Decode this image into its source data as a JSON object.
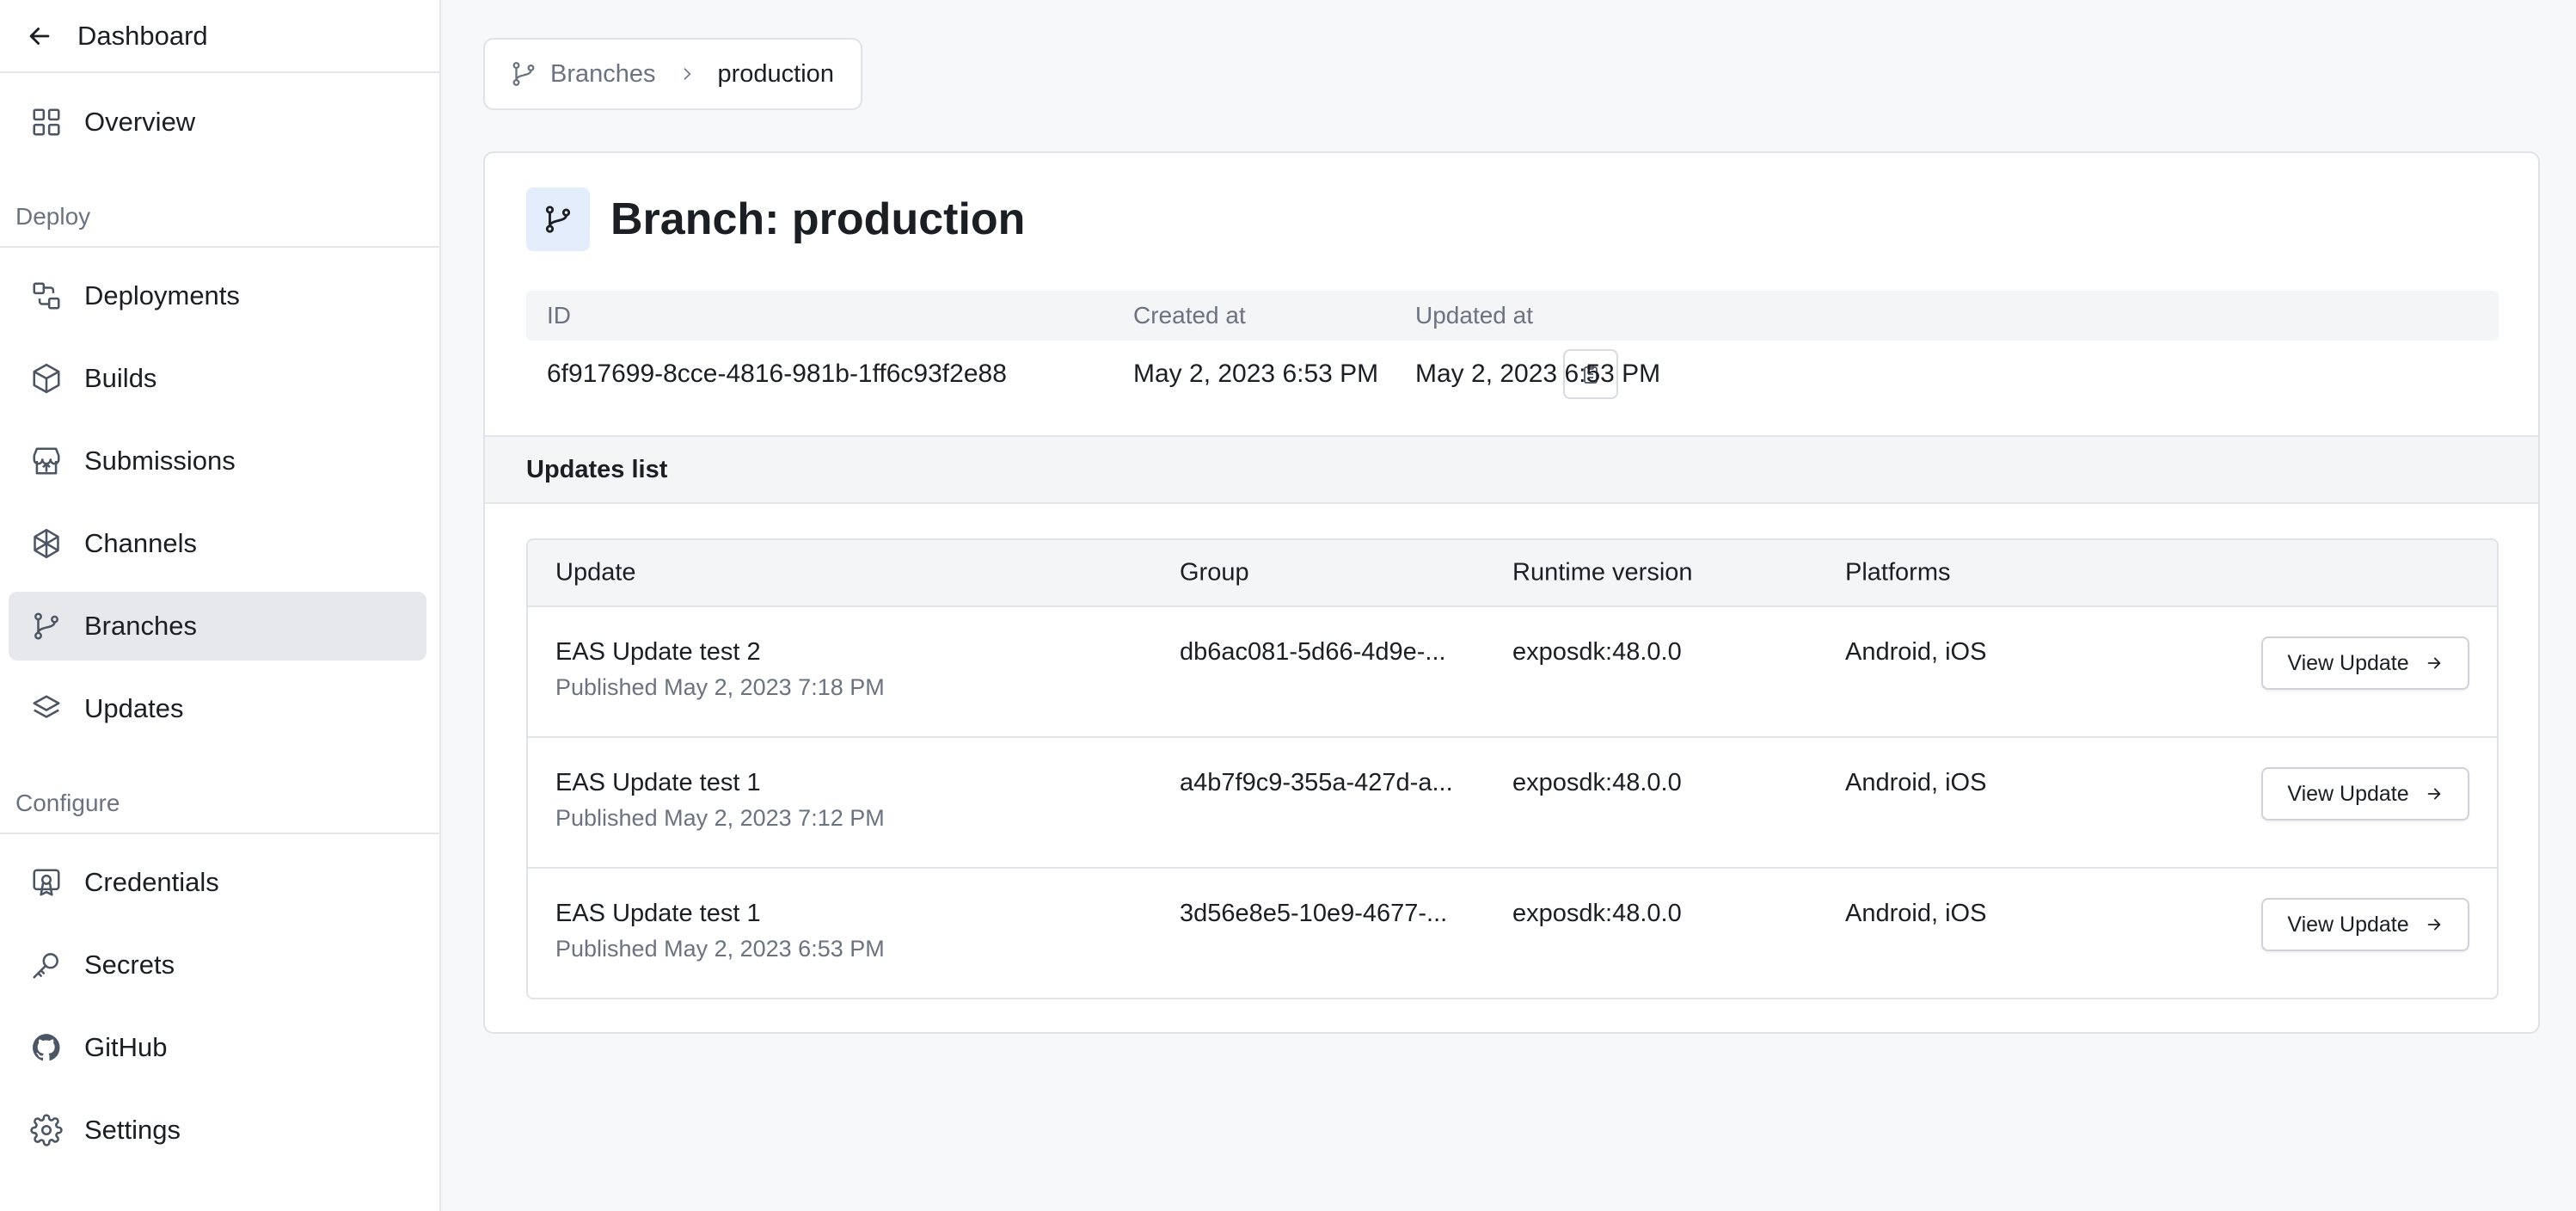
{
  "sidebar": {
    "back_label": "Dashboard",
    "overview": "Overview",
    "sections": {
      "deploy": "Deploy",
      "configure": "Configure"
    },
    "deploy_items": [
      "Deployments",
      "Builds",
      "Submissions",
      "Channels",
      "Branches",
      "Updates"
    ],
    "configure_items": [
      "Credentials",
      "Secrets",
      "GitHub",
      "Settings"
    ],
    "active_item": "Branches"
  },
  "breadcrumb": {
    "parent": "Branches",
    "current": "production"
  },
  "branch": {
    "title": "Branch: production",
    "meta_headers": {
      "id": "ID",
      "created": "Created at",
      "updated": "Updated at"
    },
    "id": "6f917699-8cce-4816-981b-1ff6c93f2e88",
    "created_at": "May 2, 2023 6:53 PM",
    "updated_at": "May 2, 2023 6:53 PM"
  },
  "updates": {
    "section_title": "Updates list",
    "columns": [
      "Update",
      "Group",
      "Runtime version",
      "Platforms"
    ],
    "view_label": "View Update",
    "rows": [
      {
        "name": "EAS Update test 2",
        "published": "Published May 2, 2023 7:18 PM",
        "group": "db6ac081-5d66-4d9e-...",
        "runtime": "exposdk:48.0.0",
        "platforms": "Android, iOS"
      },
      {
        "name": "EAS Update test 1",
        "published": "Published May 2, 2023 7:12 PM",
        "group": "a4b7f9c9-355a-427d-a...",
        "runtime": "exposdk:48.0.0",
        "platforms": "Android, iOS"
      },
      {
        "name": "EAS Update test 1",
        "published": "Published May 2, 2023 6:53 PM",
        "group": "3d56e8e5-10e9-4677-...",
        "runtime": "exposdk:48.0.0",
        "platforms": "Android, iOS"
      }
    ]
  },
  "colors": {
    "accent_bg": "#e4edfb",
    "active_nav_bg": "#e7e8eb",
    "muted_text": "#6b7280"
  }
}
